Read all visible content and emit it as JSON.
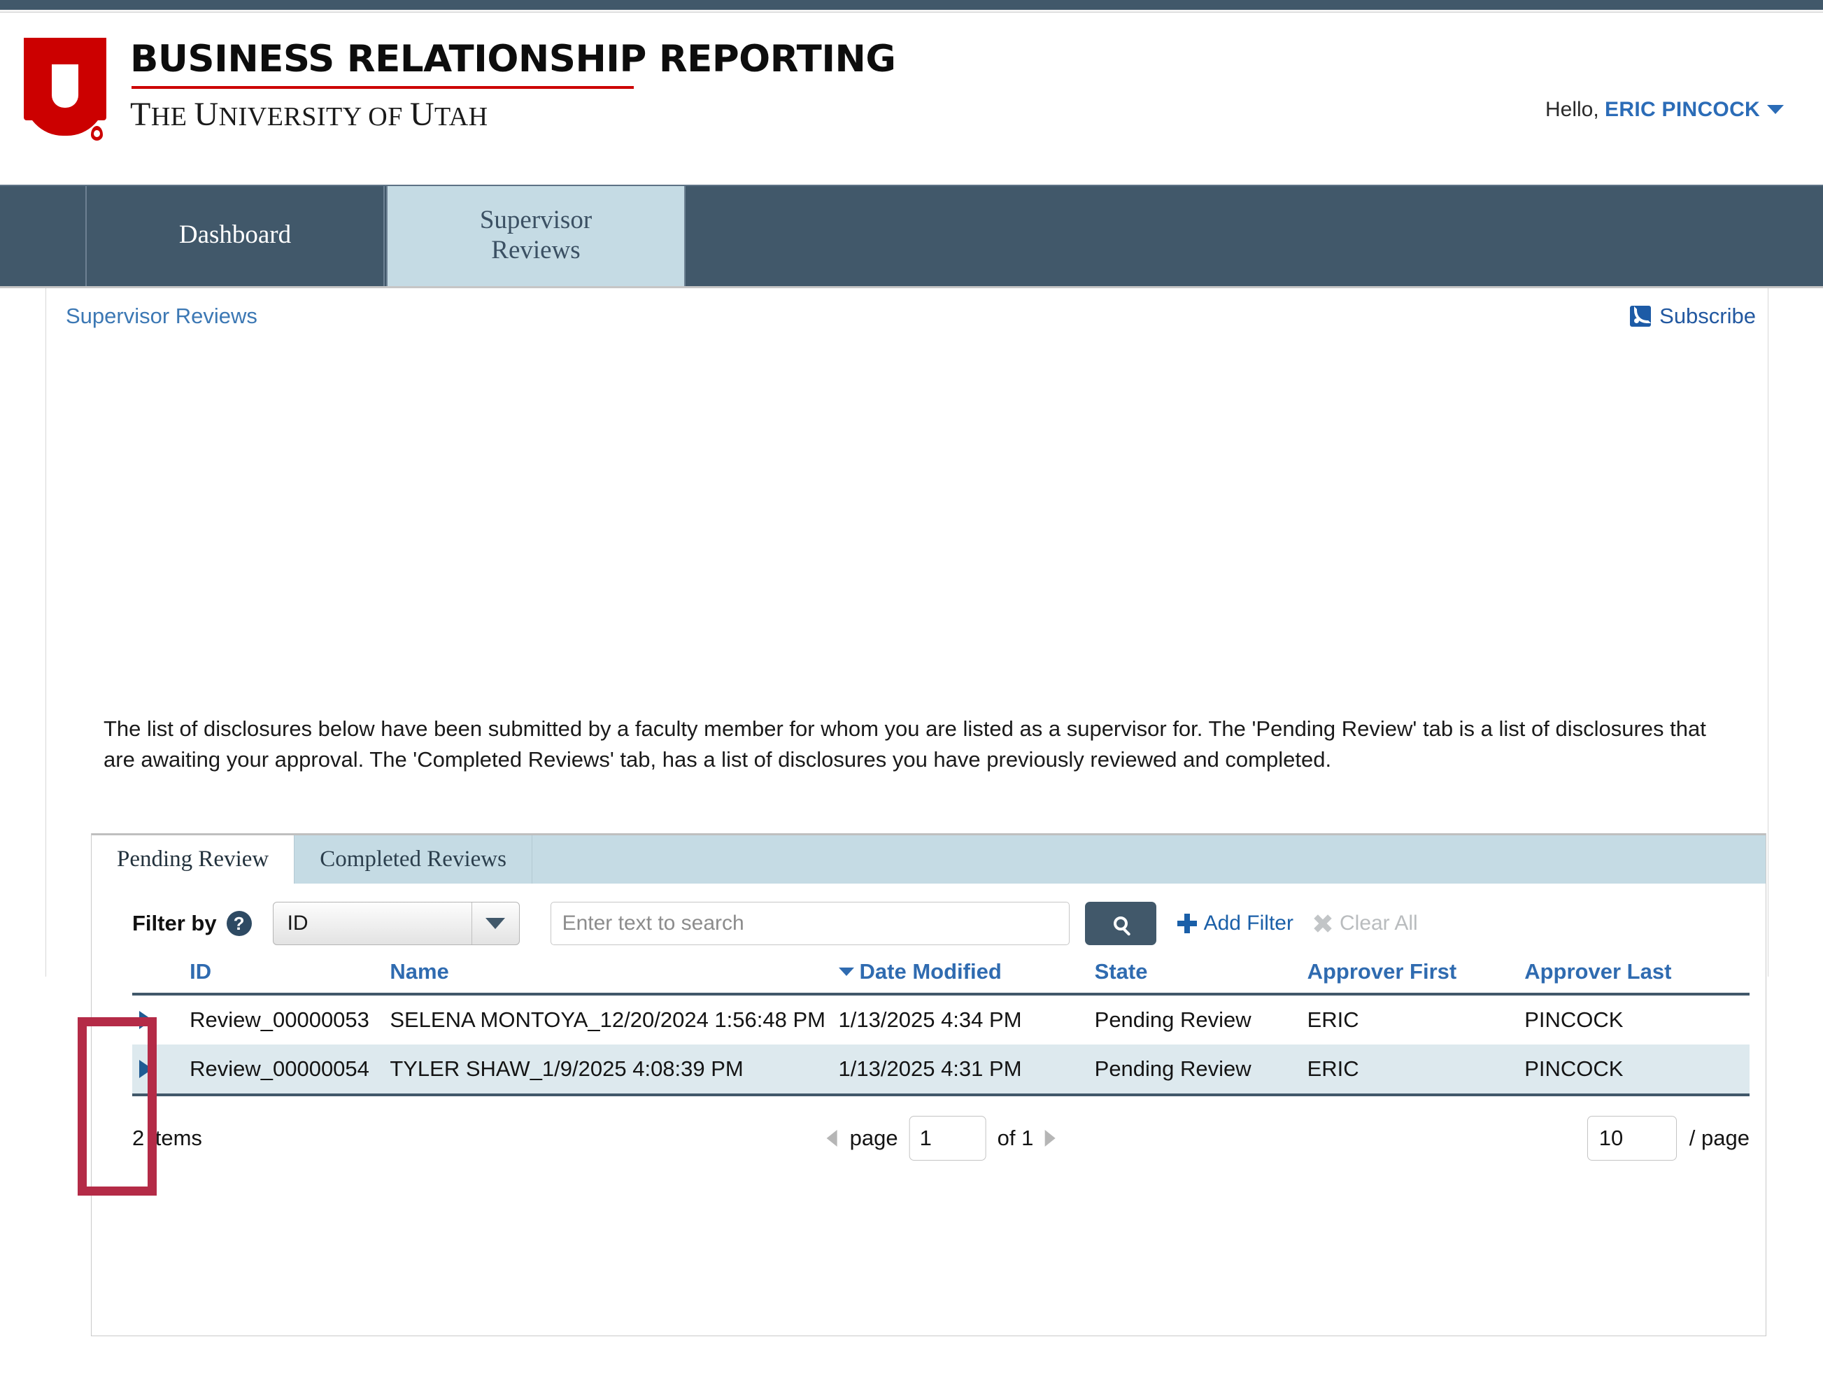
{
  "brand": {
    "title": "BUSINESS RELATIONSHIP REPORTING",
    "subtitle_parts": [
      "T",
      "HE ",
      "U",
      "NIVERSITY OF ",
      "U",
      "TAH"
    ],
    "logo_name": "university-of-utah-u-logo",
    "accent_red": "#cc0000"
  },
  "header": {
    "greeting": "Hello,",
    "user_name": "ERIC PINCOCK"
  },
  "nav": {
    "tabs": [
      {
        "label": "Dashboard",
        "state": "inactive-dark"
      },
      {
        "label": "Supervisor\nReviews",
        "line1": "Supervisor",
        "line2": "Reviews",
        "state": "current"
      }
    ]
  },
  "breadcrumb": {
    "label": "Supervisor Reviews"
  },
  "subscribe": {
    "label": "Subscribe",
    "icon": "rss-icon"
  },
  "intro": {
    "text": "The list of disclosures below have been submitted by a faculty member for whom you are listed as a supervisor for. The 'Pending Review' tab is a list of disclosures that are awaiting your approval. The 'Completed Reviews' tab, has a list of disclosures you have previously reviewed and completed."
  },
  "panel": {
    "tabs": [
      {
        "label": "Pending Review",
        "active": true
      },
      {
        "label": "Completed Reviews",
        "active": false
      }
    ],
    "filter": {
      "label": "Filter by",
      "help_icon": "?",
      "select_value": "ID",
      "search_placeholder": "Enter text to search",
      "search_value": "",
      "search_button_icon": "search-icon",
      "add_filter_label": "Add Filter",
      "clear_all_label": "Clear All"
    },
    "table": {
      "columns": [
        {
          "key": "expand",
          "label": ""
        },
        {
          "key": "id",
          "label": "ID"
        },
        {
          "key": "name",
          "label": "Name"
        },
        {
          "key": "date_modified",
          "label": "Date Modified",
          "sorted": "desc"
        },
        {
          "key": "state",
          "label": "State"
        },
        {
          "key": "approver_first",
          "label": "Approver First"
        },
        {
          "key": "approver_last",
          "label": "Approver Last"
        }
      ],
      "rows": [
        {
          "id": "Review_00000053",
          "name": "SELENA MONTOYA_12/20/2024 1:56:48 PM",
          "date_modified": "1/13/2025 4:34 PM",
          "state": "Pending Review",
          "approver_first": "ERIC",
          "approver_last": "PINCOCK"
        },
        {
          "id": "Review_00000054",
          "name": "TYLER SHAW_1/9/2025 4:08:39 PM",
          "date_modified": "1/13/2025 4:31 PM",
          "state": "Pending Review",
          "approver_first": "ERIC",
          "approver_last": "PINCOCK"
        }
      ]
    },
    "footer": {
      "items_count": "2 items",
      "page_word": "page",
      "page_value": "1",
      "of_text": "of 1",
      "per_page_value": "10",
      "per_page_label": "/ page"
    }
  },
  "annotation": {
    "shape": "rectangle",
    "color": "#b42b47",
    "target": "row-expand-arrows-column"
  }
}
